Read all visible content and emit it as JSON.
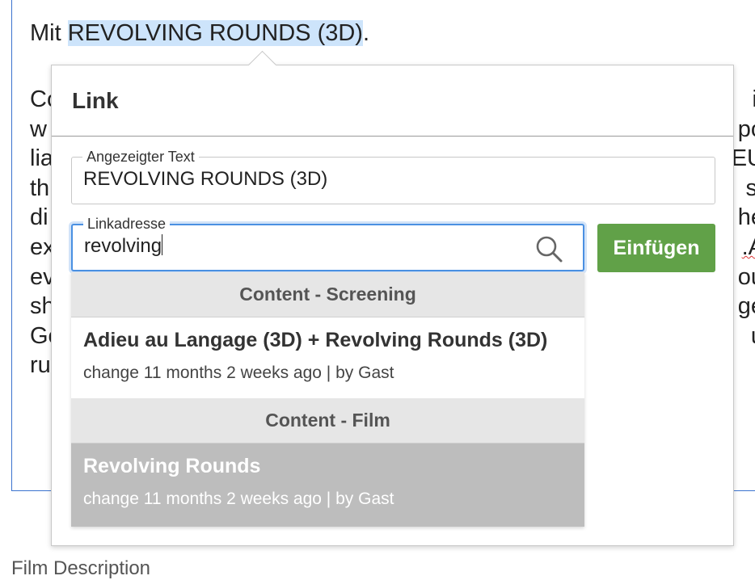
{
  "editor": {
    "line1_prefix": "Mit ",
    "line1_selected": "REVOLVING ROUNDS (3D)",
    "line1_suffix": ".",
    "paragraph_fragments": [
      {
        "left": "Co",
        "right": "it"
      },
      {
        "left": "w",
        "right": "po"
      },
      {
        "left": "lia",
        "right": "EU"
      },
      {
        "left": "th",
        "right": "st"
      },
      {
        "left": "di",
        "right": "he"
      },
      {
        "left": "ex",
        "right": ".A"
      },
      {
        "left": "ev",
        "right": "ou"
      },
      {
        "left": "sh",
        "right": "ge"
      },
      {
        "left": "Go",
        "right": "u"
      },
      {
        "left": "ru",
        "right": ""
      }
    ],
    "below_label": "Film Description"
  },
  "dialog": {
    "title": "Link",
    "display_text_label": "Angezeigter Text",
    "display_text_value": "REVOLVING ROUNDS (3D)",
    "link_address_label": "Linkadresse",
    "link_address_value": "revolving",
    "insert_button": "Einfügen",
    "search_icon": "search-icon"
  },
  "dropdown": {
    "groups": [
      {
        "header": "Content - Screening",
        "items": [
          {
            "title": "Adieu au Langage (3D) + Revolving Rounds (3D)",
            "meta": "change 11 months 2 weeks ago | by Gast"
          }
        ]
      },
      {
        "header": "Content - Film",
        "items": [
          {
            "title": "Revolving Rounds",
            "meta": "change 11 months 2 weeks ago | by Gast"
          }
        ]
      }
    ]
  },
  "colors": {
    "accent_blue": "#3b73cf",
    "selection": "#cde4fb",
    "insert_green": "#61a148",
    "active_item": "#bdbdbd"
  }
}
